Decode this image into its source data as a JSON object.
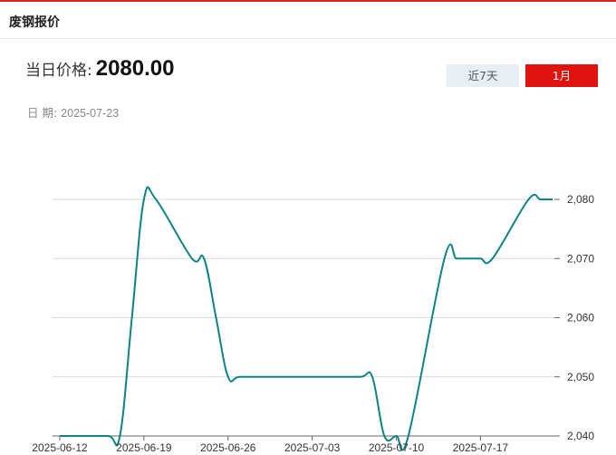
{
  "header": {
    "title": "废钢报价"
  },
  "price": {
    "label": "当日价格:",
    "value": "2080.00"
  },
  "date": {
    "label": "日 期:",
    "value": "2025-07-23"
  },
  "range_buttons": {
    "week_label": "近7天",
    "month_label": "1月",
    "active": "1月"
  },
  "colors": {
    "accent": "#e0130f",
    "line": "#0c8485",
    "grid": "#d9d9d9",
    "inactive_button_bg": "#e6eef6"
  },
  "chart_data": {
    "type": "line",
    "title": "",
    "xlabel": "",
    "ylabel": "",
    "ylim": [
      2040,
      2080
    ],
    "yticks": [
      2040,
      2050,
      2060,
      2070,
      2080
    ],
    "ytick_labels": [
      "2,040",
      "2,050",
      "2,060",
      "2,070",
      "2,080"
    ],
    "x_tick_labels": [
      "2025-06-12",
      "2025-06-19",
      "2025-06-26",
      "2025-07-03",
      "2025-07-10",
      "2025-07-17"
    ],
    "x": [
      "2025-06-12",
      "2025-06-13",
      "2025-06-16",
      "2025-06-17",
      "2025-06-18",
      "2025-06-19",
      "2025-06-20",
      "2025-06-23",
      "2025-06-24",
      "2025-06-25",
      "2025-06-26",
      "2025-06-27",
      "2025-06-30",
      "2025-07-01",
      "2025-07-02",
      "2025-07-03",
      "2025-07-04",
      "2025-07-07",
      "2025-07-08",
      "2025-07-09",
      "2025-07-10",
      "2025-07-11",
      "2025-07-14",
      "2025-07-15",
      "2025-07-16",
      "2025-07-17",
      "2025-07-18",
      "2025-07-21",
      "2025-07-22",
      "2025-07-23"
    ],
    "series": [
      {
        "values": [
          2040,
          2040,
          2040,
          2040,
          2060,
          2080,
          2080,
          2070,
          2070,
          2060,
          2050,
          2050,
          2050,
          2050,
          2050,
          2050,
          2050,
          2050,
          2050,
          2040,
          2040,
          2040,
          2070,
          2070,
          2070,
          2070,
          2070,
          2080,
          2080,
          2080
        ]
      }
    ],
    "grid": true,
    "y_axis_position": "right",
    "legend": "none"
  }
}
